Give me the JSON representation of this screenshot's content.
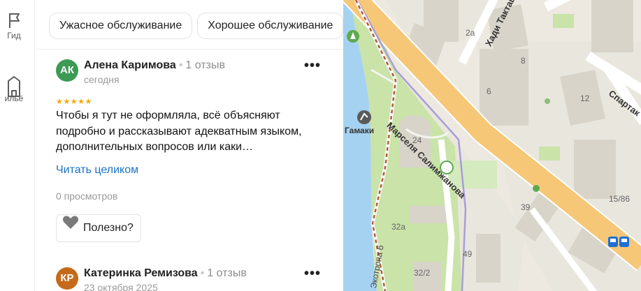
{
  "rail": {
    "items": [
      {
        "label": "Гид",
        "icon": "flag-icon"
      },
      {
        "label": "ильё",
        "icon": "building-icon"
      }
    ]
  },
  "filters": {
    "chips": [
      "Ужасное обслуживание",
      "Хорошее обслуживание"
    ]
  },
  "reviews": [
    {
      "initials": "АК",
      "avatar_color": "#3c9a54",
      "author": "Алена Каримова",
      "review_count": "1 отзыв",
      "date": "сегодня",
      "stars": "★★★★★",
      "text": "Чтобы я тут не оформляла, всё объясняют подробно и рассказывают адекватным языком, дополнительных вопросов или каки…",
      "read_more": "Читать целиком",
      "views": "0 просмотров",
      "useful": "Полезно?"
    },
    {
      "initials": "КР",
      "avatar_color": "#c56a1a",
      "author": "Катеринка Ремизова",
      "review_count": "1 отзыв",
      "date": "23 октября 2025"
    }
  ],
  "map": {
    "streets": [
      "Марселя Салимжанова",
      "Хади Такташа",
      "Спартак",
      "Экотропа б"
    ],
    "poi": "Гамаки",
    "houses": [
      "2а",
      "8",
      "6",
      "12",
      "24",
      "39",
      "32а",
      "49",
      "32/2",
      "15/86"
    ],
    "transit_icon": "bus-stop-icon"
  },
  "colors": {
    "link": "#1a73c7",
    "star": "#f7a700",
    "water": "#a6d2f2",
    "park": "#c9e3a8",
    "main_road": "#f5c777"
  }
}
